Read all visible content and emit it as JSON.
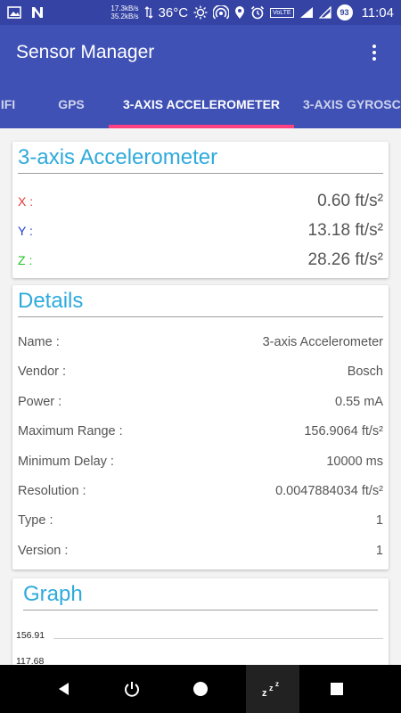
{
  "status_bar": {
    "speed_up": "17.3kB/s",
    "speed_down": "35.2kB/s",
    "temperature": "36°C",
    "lte_label": "VoLTE",
    "battery": "93",
    "time": "11:04"
  },
  "app_bar": {
    "title": "Sensor Manager"
  },
  "tabs": [
    {
      "label": "IFI",
      "active": false
    },
    {
      "label": "GPS",
      "active": false
    },
    {
      "label": "3-AXIS ACCELEROMETER",
      "active": true
    },
    {
      "label": "3-AXIS GYROSC",
      "active": false
    }
  ],
  "accelerometer_card": {
    "title": "3-axis Accelerometer",
    "rows": [
      {
        "label": "X :",
        "value": "0.60 ft/s²",
        "color": "#e53935"
      },
      {
        "label": "Y :",
        "value": "13.18 ft/s²",
        "color": "#1e3fd1"
      },
      {
        "label": "Z :",
        "value": "28.26 ft/s²",
        "color": "#22c122"
      }
    ]
  },
  "details_card": {
    "title": "Details",
    "rows": [
      {
        "label": "Name :",
        "value": "3-axis Accelerometer"
      },
      {
        "label": "Vendor :",
        "value": "Bosch"
      },
      {
        "label": "Power :",
        "value": "0.55 mA"
      },
      {
        "label": "Maximum Range :",
        "value": "156.9064 ft/s²"
      },
      {
        "label": "Minimum Delay :",
        "value": "10000 ms"
      },
      {
        "label": "Resolution :",
        "value": "0.0047884034 ft/s²"
      },
      {
        "label": "Type :",
        "value": "1"
      },
      {
        "label": "Version :",
        "value": "1"
      }
    ]
  },
  "graph_card": {
    "title": "Graph",
    "y_ticks": [
      "156.91",
      "117.68"
    ]
  },
  "nav_bar": {
    "buttons": [
      "back-icon",
      "power-icon",
      "home-icon",
      "sleep-icon",
      "recents-icon"
    ]
  },
  "colors": {
    "status_bar": "#3443a4",
    "primary": "#3f51b5",
    "accent": "#ff4081",
    "card_title": "#2eaadc"
  }
}
